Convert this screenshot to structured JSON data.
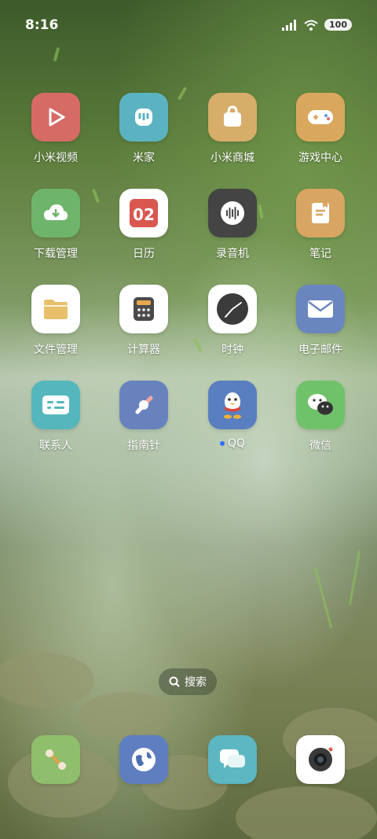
{
  "status_bar": {
    "time": "8:16",
    "battery": "100"
  },
  "apps": [
    {
      "label": "小米视频",
      "color": "#d66b66",
      "icon": "play-icon"
    },
    {
      "label": "米家",
      "color": "#5bb3c1",
      "icon": "mijia-icon"
    },
    {
      "label": "小米商城",
      "color": "#d7ad6a",
      "icon": "bag-icon"
    },
    {
      "label": "游戏中心",
      "color": "#d9a85e",
      "icon": "gamepad-icon"
    },
    {
      "label": "下载管理",
      "color": "#6eb56b",
      "icon": "download-icon"
    },
    {
      "label": "日历",
      "color": "#ffffff",
      "icon": "calendar-icon",
      "calendar_day": "02"
    },
    {
      "label": "录音机",
      "color": "#444444",
      "icon": "recorder-icon"
    },
    {
      "label": "笔记",
      "color": "#d8a563",
      "icon": "notes-icon"
    },
    {
      "label": "文件管理",
      "color": "#ffffff",
      "icon": "folder-icon"
    },
    {
      "label": "计算器",
      "color": "#ffffff",
      "icon": "calculator-icon"
    },
    {
      "label": "时钟",
      "color": "#ffffff",
      "icon": "clock-icon"
    },
    {
      "label": "电子邮件",
      "color": "#6a86be",
      "icon": "mail-icon"
    },
    {
      "label": "联系人",
      "color": "#55b7bd",
      "icon": "contacts-icon"
    },
    {
      "label": "指南针",
      "color": "#6882be",
      "icon": "compass-icon"
    },
    {
      "label": "QQ",
      "color": "#5a7fc0",
      "icon": "qq-penguin-icon",
      "new_dot": true
    },
    {
      "label": "微信",
      "color": "#70c26a",
      "icon": "wechat-icon"
    }
  ],
  "search": {
    "label": "搜索"
  },
  "dock": [
    {
      "name": "phone",
      "color": "#8fbf6c",
      "icon": "phone-icon"
    },
    {
      "name": "browser",
      "color": "#5f7ec0",
      "icon": "globe-icon"
    },
    {
      "name": "messages",
      "color": "#5cb7c2",
      "icon": "messages-icon"
    },
    {
      "name": "camera",
      "color": "#ffffff",
      "icon": "camera-icon"
    }
  ]
}
